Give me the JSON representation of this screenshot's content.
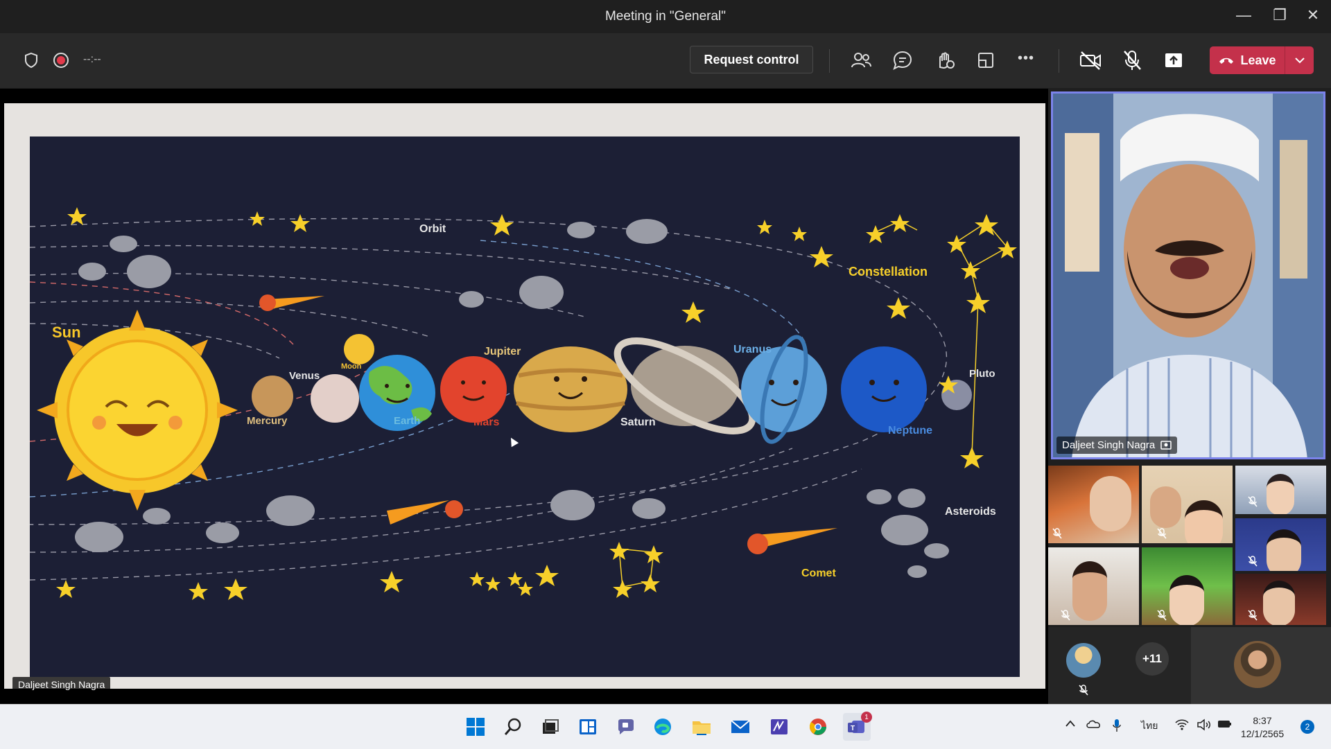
{
  "window": {
    "title": "Meeting in \"General\"",
    "minimize": "—",
    "restore": "❐",
    "close": "✕"
  },
  "toolbar": {
    "timer": "--:--",
    "request_control": "Request control",
    "leave_label": "Leave",
    "more": "•••"
  },
  "slide": {
    "labels": {
      "sun": "Sun",
      "mercury": "Mercury",
      "venus": "Venus",
      "moon": "Moon",
      "earth": "Earth",
      "mars": "Mars",
      "jupiter": "Jupiter",
      "saturn": "Saturn",
      "uranus": "Uranus",
      "neptune": "Neptune",
      "pluto": "Pluto",
      "orbit": "Orbit",
      "constellation": "Constellation",
      "asteroids": "Asteroids",
      "comet": "Comet"
    },
    "presenter": "Daljeet Singh Nagra"
  },
  "speaker": {
    "name": "Daljeet Singh Nagra"
  },
  "overflow": {
    "count": "+11"
  },
  "taskbar": {
    "time": "8:37",
    "date": "12/1/2565",
    "language": "ไทย",
    "notifications": "2",
    "teams_badge": "1"
  },
  "colors": {
    "leave": "#c4314b",
    "speaker_border": "#7b83eb",
    "slide_bg": "#1c1f35",
    "accent": "#0067c0"
  }
}
